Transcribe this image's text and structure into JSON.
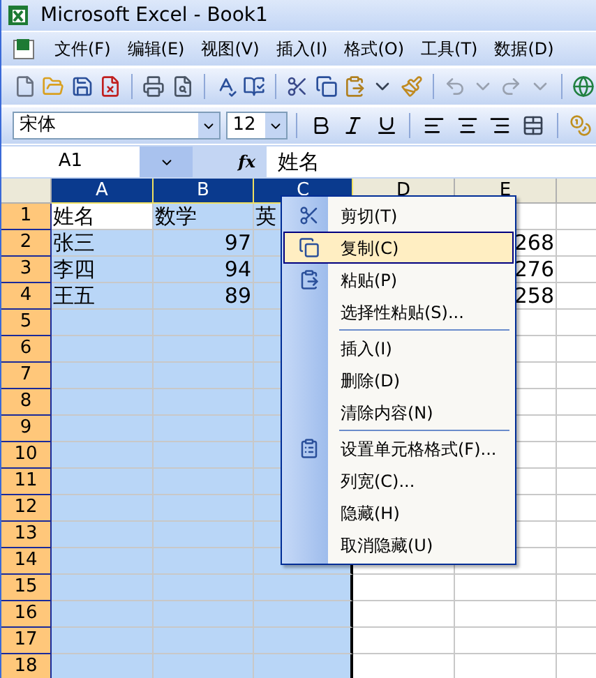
{
  "window": {
    "title": "Microsoft Excel - Book1"
  },
  "menu_bar": [
    {
      "label": "文件(F)"
    },
    {
      "label": "编辑(E)"
    },
    {
      "label": "视图(V)"
    },
    {
      "label": "插入(I)"
    },
    {
      "label": "格式(O)"
    },
    {
      "label": "工具(T)"
    },
    {
      "label": "数据(D)"
    }
  ],
  "formatting_toolbar": {
    "font": "宋体",
    "size": "12"
  },
  "formula_bar": {
    "name_box": "A1",
    "function_label": "fx",
    "value": "姓名"
  },
  "columns": [
    {
      "label": "A",
      "selected": true
    },
    {
      "label": "B",
      "selected": true
    },
    {
      "label": "C",
      "selected": true
    },
    {
      "label": "D",
      "selected": false
    },
    {
      "label": "E",
      "selected": false
    }
  ],
  "rows": [
    {
      "label": "1",
      "selected": true,
      "cells": [
        {
          "text": "姓名",
          "kind": "text",
          "active": true
        },
        {
          "text": "数学",
          "kind": "text",
          "active": false
        },
        {
          "text": "英",
          "kind": "text",
          "active": false
        },
        null,
        null
      ]
    },
    {
      "label": "2",
      "selected": true,
      "cells": [
        {
          "text": "张三",
          "kind": "text",
          "active": false
        },
        {
          "text": "97",
          "kind": "number",
          "active": false
        },
        null,
        null,
        {
          "text": "268",
          "kind": "number",
          "active": false
        }
      ]
    },
    {
      "label": "3",
      "selected": true,
      "cells": [
        {
          "text": "李四",
          "kind": "text",
          "active": false
        },
        {
          "text": "94",
          "kind": "number",
          "active": false
        },
        null,
        null,
        {
          "text": "276",
          "kind": "number",
          "active": false
        }
      ]
    },
    {
      "label": "4",
      "selected": true,
      "cells": [
        {
          "text": "王五",
          "kind": "text",
          "active": false
        },
        {
          "text": "89",
          "kind": "number",
          "active": false
        },
        null,
        null,
        {
          "text": "258",
          "kind": "number",
          "active": false
        }
      ]
    },
    {
      "label": "5",
      "selected": true
    },
    {
      "label": "6",
      "selected": true
    },
    {
      "label": "7",
      "selected": true
    },
    {
      "label": "8",
      "selected": true
    },
    {
      "label": "9",
      "selected": true
    },
    {
      "label": "10",
      "selected": true
    },
    {
      "label": "11",
      "selected": true
    },
    {
      "label": "12",
      "selected": true
    },
    {
      "label": "13",
      "selected": true
    },
    {
      "label": "14",
      "selected": true
    },
    {
      "label": "15",
      "selected": true
    },
    {
      "label": "16",
      "selected": true
    },
    {
      "label": "17",
      "selected": true
    },
    {
      "label": "18",
      "selected": true
    }
  ],
  "context_menu": [
    {
      "kind": "item",
      "label": "剪切(T)",
      "selected": false
    },
    {
      "kind": "item",
      "label": "复制(C)",
      "selected": true
    },
    {
      "kind": "item",
      "label": "粘贴(P)",
      "selected": false
    },
    {
      "kind": "item",
      "label": "选择性粘贴(S)...",
      "selected": false
    },
    {
      "kind": "separator"
    },
    {
      "kind": "item",
      "label": "插入(I)",
      "selected": false
    },
    {
      "kind": "item",
      "label": "删除(D)",
      "selected": false
    },
    {
      "kind": "item",
      "label": "清除内容(N)",
      "selected": false
    },
    {
      "kind": "separator"
    },
    {
      "kind": "item",
      "label": "设置单元格格式(F)...",
      "selected": false
    },
    {
      "kind": "item",
      "label": "列宽(C)...",
      "selected": false
    },
    {
      "kind": "item",
      "label": "隐藏(H)",
      "selected": false
    },
    {
      "kind": "item",
      "label": "取消隐藏(U)",
      "selected": false
    }
  ]
}
